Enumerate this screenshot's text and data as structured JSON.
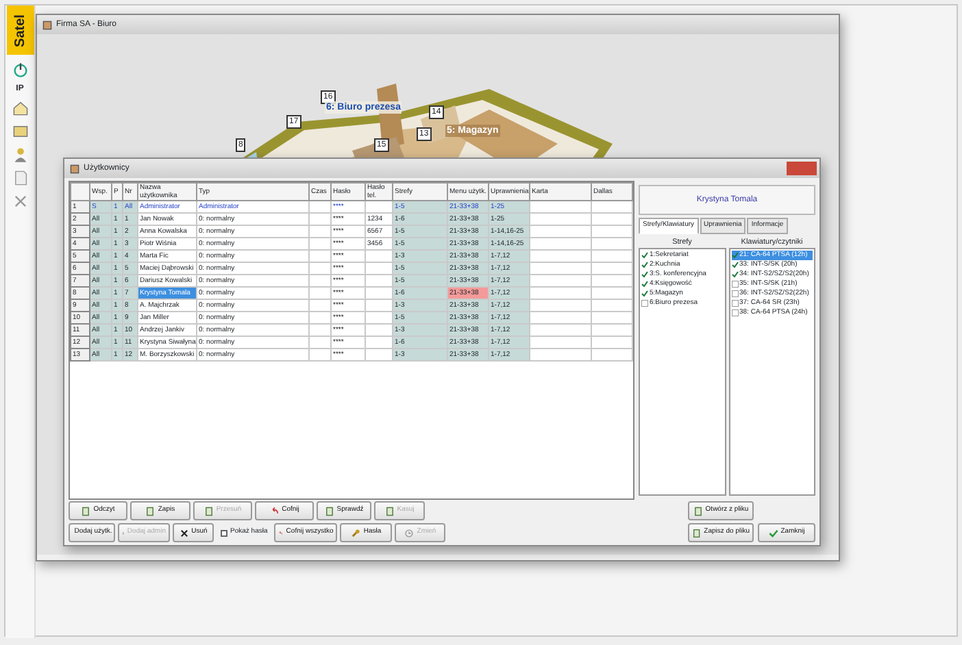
{
  "sidebar": {
    "logo": "Satel",
    "ip_label": "IP"
  },
  "plan_window": {
    "title": "Firma SA - Biuro",
    "zones": [
      {
        "label": "6: Biuro prezesa"
      },
      {
        "label": "5: Magazyn"
      }
    ],
    "markers": [
      "16",
      "17",
      "8",
      "14",
      "13",
      "15"
    ]
  },
  "users_window": {
    "title": "Użytkownicy",
    "columns": [
      "",
      "Wsp.",
      "P",
      "Nr",
      "Nazwa użytkownika",
      "Typ",
      "Czas",
      "Hasło",
      "Hasło tel.",
      "Strefy",
      "Menu użytk.",
      "Uprawnienia",
      "Karta",
      "Dallas"
    ],
    "rows": [
      {
        "kind": "admin",
        "selected": false,
        "warning": false,
        "cells": [
          "1",
          "S",
          "1",
          "All",
          "Administrator",
          "Administrator",
          "",
          "****",
          "",
          "1-5",
          "21-33+38",
          "1-25",
          "",
          ""
        ]
      },
      {
        "kind": "user",
        "selected": false,
        "warning": false,
        "cells": [
          "2",
          "All",
          "1",
          "1",
          "Jan Nowak",
          "0: normalny",
          "",
          "****",
          "1234",
          "1-6",
          "21-33+38",
          "1-25",
          "",
          ""
        ]
      },
      {
        "kind": "user",
        "selected": false,
        "warning": false,
        "cells": [
          "3",
          "All",
          "1",
          "2",
          "Anna Kowalska",
          "0: normalny",
          "",
          "****",
          "6567",
          "1-5",
          "21-33+38",
          "1-14,16-25",
          "",
          ""
        ]
      },
      {
        "kind": "user",
        "selected": false,
        "warning": false,
        "cells": [
          "4",
          "All",
          "1",
          "3",
          "Piotr Wiśnia",
          "0: normalny",
          "",
          "****",
          "3456",
          "1-5",
          "21-33+38",
          "1-14,16-25",
          "",
          ""
        ]
      },
      {
        "kind": "user",
        "selected": false,
        "warning": false,
        "cells": [
          "5",
          "All",
          "1",
          "4",
          "Marta Fic",
          "0: normalny",
          "",
          "****",
          "",
          "1-3",
          "21-33+38",
          "1-7,12",
          "",
          ""
        ]
      },
      {
        "kind": "user",
        "selected": false,
        "warning": false,
        "cells": [
          "6",
          "All",
          "1",
          "5",
          "Maciej Dąbrowski",
          "0: normalny",
          "",
          "****",
          "",
          "1-5",
          "21-33+38",
          "1-7,12",
          "",
          ""
        ]
      },
      {
        "kind": "user",
        "selected": false,
        "warning": false,
        "cells": [
          "7",
          "All",
          "1",
          "6",
          "Dariusz Kowalski",
          "0: normalny",
          "",
          "****",
          "",
          "1-5",
          "21-33+38",
          "1-7,12",
          "",
          ""
        ]
      },
      {
        "kind": "user",
        "selected": true,
        "warning": true,
        "cells": [
          "8",
          "All",
          "1",
          "7",
          "Krystyna Tomala",
          "0: normalny",
          "",
          "****",
          "",
          "1-6",
          "21-33+38",
          "1-7,12",
          "",
          ""
        ]
      },
      {
        "kind": "user",
        "selected": false,
        "warning": false,
        "cells": [
          "9",
          "All",
          "1",
          "8",
          "A. Majchrzak",
          "0: normalny",
          "",
          "****",
          "",
          "1-3",
          "21-33+38",
          "1-7,12",
          "",
          ""
        ]
      },
      {
        "kind": "user",
        "selected": false,
        "warning": false,
        "cells": [
          "10",
          "All",
          "1",
          "9",
          "Jan Miller",
          "0: normalny",
          "",
          "****",
          "",
          "1-5",
          "21-33+38",
          "1-7,12",
          "",
          ""
        ]
      },
      {
        "kind": "user",
        "selected": false,
        "warning": false,
        "cells": [
          "11",
          "All",
          "1",
          "10",
          "Andrzej Jankiv",
          "0: normalny",
          "",
          "****",
          "",
          "1-3",
          "21-33+38",
          "1-7,12",
          "",
          ""
        ]
      },
      {
        "kind": "user",
        "selected": false,
        "warning": false,
        "cells": [
          "12",
          "All",
          "1",
          "11",
          "Krystyna Siwałyna",
          "0: normalny",
          "",
          "****",
          "",
          "1-6",
          "21-33+38",
          "1-7,12",
          "",
          ""
        ]
      },
      {
        "kind": "user",
        "selected": false,
        "warning": false,
        "cells": [
          "13",
          "All",
          "1",
          "12",
          "M. Borzyszkowski",
          "0: normalny",
          "",
          "****",
          "",
          "1-3",
          "21-33+38",
          "1-7,12",
          "",
          ""
        ]
      }
    ],
    "panel": {
      "user_name": "Krystyna Tomala",
      "tabs": [
        {
          "label": "Strefy/Klawiatury",
          "selected": true
        },
        {
          "label": "Uprawnienia",
          "selected": false
        },
        {
          "label": "Informacje",
          "selected": false
        }
      ],
      "zones": {
        "title": "Strefy",
        "items": [
          {
            "label": "1:Sekretariat",
            "checked": true
          },
          {
            "label": "2:Kuchnia",
            "checked": true
          },
          {
            "label": "3:S. konferencyjna",
            "checked": true
          },
          {
            "label": "4:Księgowość",
            "checked": true
          },
          {
            "label": "5:Magazyn",
            "checked": true
          },
          {
            "label": "6:Biuro prezesa",
            "checked": false
          }
        ]
      },
      "keypads": {
        "title": "Klawiatury/czytniki",
        "items": [
          {
            "label": "21: CA-64 PTSA (12h)",
            "checked": true,
            "selected": true
          },
          {
            "label": "33: INT-S/SK (20h)",
            "checked": true,
            "selected": false
          },
          {
            "label": "34: INT-S2/SZ/S2(20h)",
            "checked": true,
            "selected": false
          },
          {
            "label": "35: INT-S/SK (21h)",
            "checked": false,
            "selected": false
          },
          {
            "label": "36: INT-S2/SZ/S2(22h)",
            "checked": false,
            "selected": false
          },
          {
            "label": "37: CA-64 SR (23h)",
            "checked": false,
            "selected": false
          },
          {
            "label": "38: CA-64 PTSA (24h)",
            "checked": false,
            "selected": false
          }
        ]
      }
    },
    "button_rows": [
      [
        {
          "kind": "button",
          "label": "Odczyt",
          "disabled": false
        },
        {
          "kind": "button",
          "label": "Zapis",
          "disabled": false
        },
        {
          "kind": "button",
          "label": "Przesuń",
          "disabled": true
        },
        {
          "kind": "button",
          "label": "Cofnij",
          "disabled": false
        },
        {
          "kind": "button",
          "label": "Sprawdź",
          "disabled": false
        },
        {
          "kind": "button",
          "label": "Kasuj",
          "disabled": true
        }
      ],
      [
        {
          "kind": "button",
          "label": "Dodaj użytk.",
          "disabled": false
        },
        {
          "kind": "button",
          "label": "Dodaj admin",
          "disabled": true
        },
        {
          "kind": "button",
          "label": "Usuń",
          "disabled": false
        },
        {
          "kind": "checkbox",
          "label": "Pokaż hasła",
          "checked": false
        },
        {
          "kind": "button",
          "label": "Cofnij wszystko",
          "disabled": false
        },
        {
          "kind": "button",
          "label": "Hasła",
          "disabled": false
        },
        {
          "kind": "button",
          "label": "Zmień",
          "disabled": true
        }
      ]
    ],
    "file_buttons": [
      {
        "label": "Otwórz z pliku"
      },
      {
        "label": "Zapisz do pliku"
      },
      {
        "label": "Zamknij"
      }
    ]
  }
}
